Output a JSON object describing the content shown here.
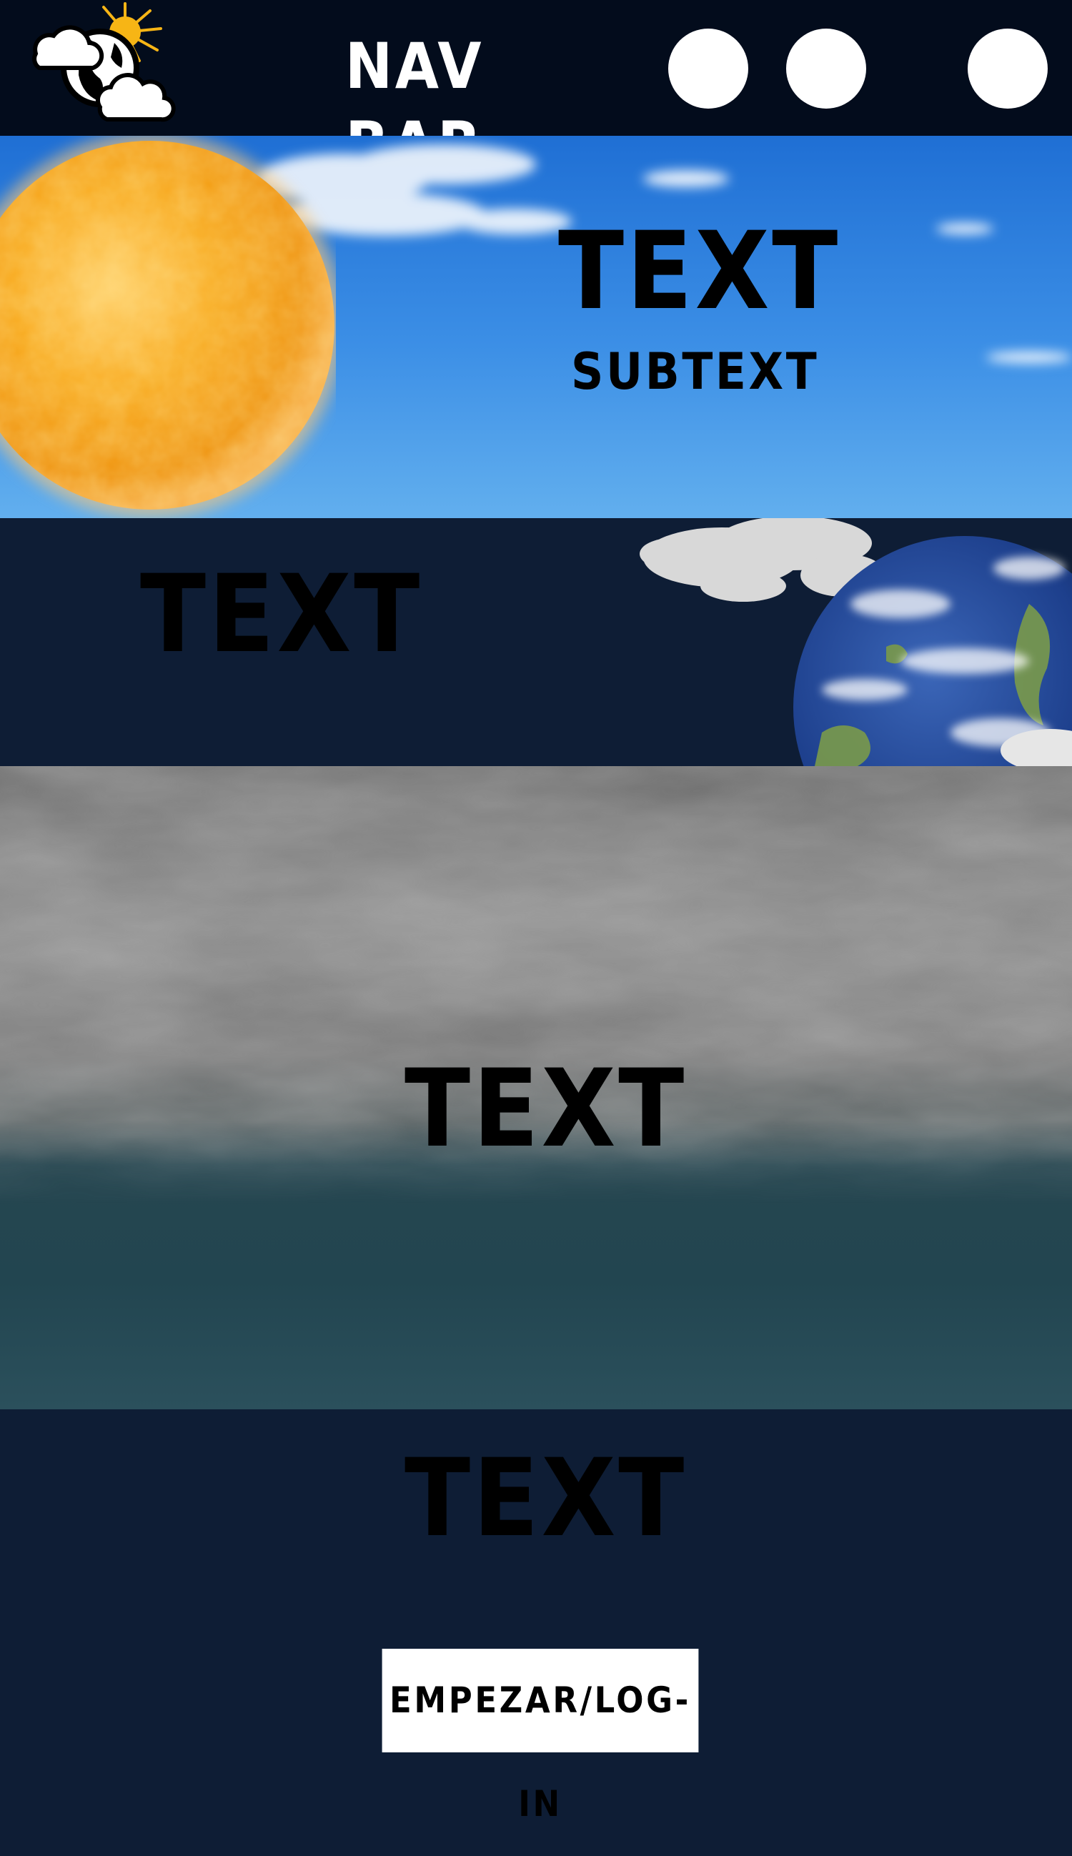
{
  "nav": {
    "title": "NAV BAR",
    "logo_icon": "weather-globe-logo",
    "buttons": [
      "nav-button-1",
      "nav-button-2",
      "nav-button-3"
    ]
  },
  "hero": {
    "title": "TEXT",
    "subtitle": "SUBTEXT"
  },
  "section2": {
    "title": "TEXT"
  },
  "section3": {
    "title": "TEXT"
  },
  "section4": {
    "title": "TEXT",
    "cta_label": "EMPEZAR/LOG-IN"
  },
  "colors": {
    "nav_bg": "#030c1c",
    "section_bg": "#0e1d35",
    "sky_blue": "#3c8fe6",
    "sun_orange": "#f4a41a",
    "button_bg": "#ffffff"
  }
}
